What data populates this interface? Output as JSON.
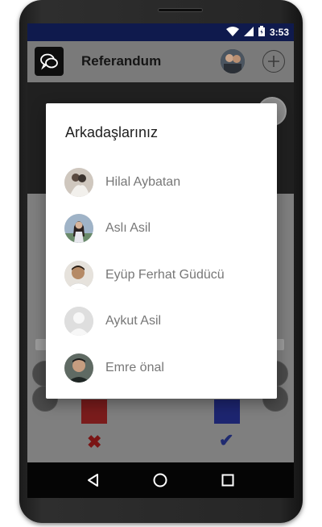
{
  "status_bar": {
    "time": "3:53",
    "icons": [
      "wifi-icon",
      "cell-signal-icon",
      "battery-icon"
    ]
  },
  "app_bar": {
    "title": "Referandum",
    "logo_icon": "chat-bubbles-icon",
    "add_icon": "plus-icon"
  },
  "dialog": {
    "title": "Arkadaşlarınız",
    "friends": [
      {
        "name": "Hilal Aybatan",
        "avatar": "couple-photo"
      },
      {
        "name": "Aslı Asil",
        "avatar": "woman-photo"
      },
      {
        "name": "Eyüp Ferhat Güdücü",
        "avatar": "man-photo"
      },
      {
        "name": "Aykut Asil",
        "avatar": "default-avatar"
      },
      {
        "name": "Emre önal",
        "avatar": "man-portrait-photo"
      }
    ]
  },
  "vote": {
    "reject_icon": "x-icon",
    "approve_icon": "check-icon",
    "reject_color": "#7a1c1c",
    "approve_color": "#1d2570"
  },
  "nav_bar": {
    "icons": [
      "back-triangle-icon",
      "home-circle-icon",
      "recents-square-icon"
    ]
  },
  "colors": {
    "status_bar": "#0f1a4d",
    "dialog_bg": "#ffffff",
    "friend_name": "#777777"
  }
}
